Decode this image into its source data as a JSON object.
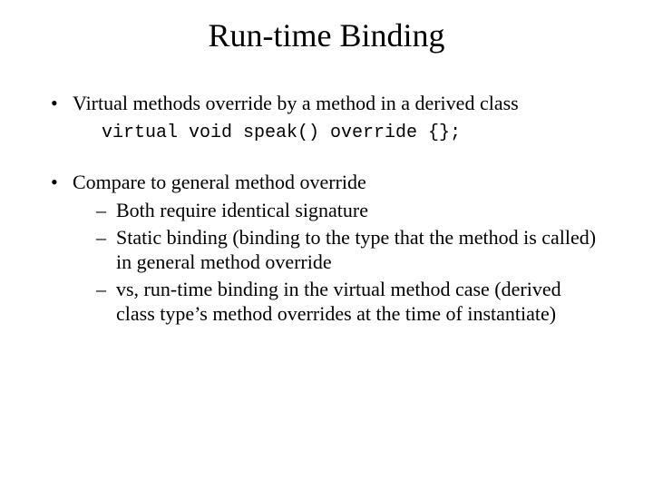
{
  "title": "Run-time Binding",
  "bullets": [
    {
      "text": "Virtual methods override by a method in a derived class",
      "code": "virtual void speak() override {};"
    },
    {
      "text": "Compare to general method override",
      "sub": [
        "Both require identical signature",
        "Static binding (binding to the type that the method is called) in general method override",
        "vs, run-time binding in the virtual method case (derived class type’s method overrides at the time of instantiate)"
      ]
    }
  ]
}
